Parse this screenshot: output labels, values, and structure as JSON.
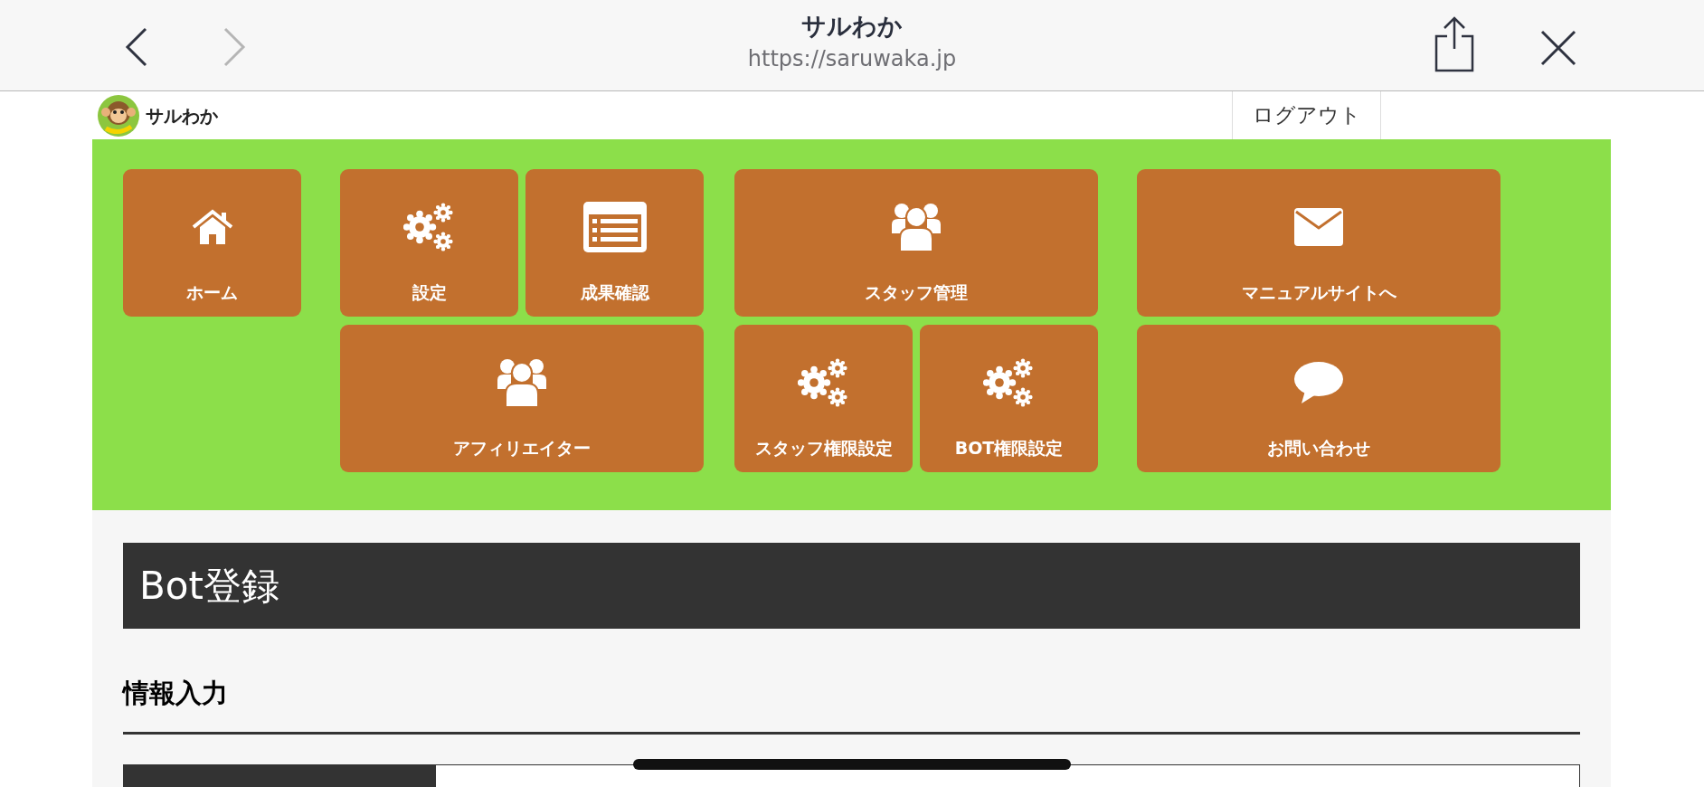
{
  "browser": {
    "title": "サルわか",
    "url": "https://saruwaka.jp"
  },
  "site": {
    "logo_text": "サルわか",
    "logout": "ログアウト"
  },
  "menu_groups": [
    {
      "tiles": [
        {
          "label": "ホーム",
          "kind": "home"
        }
      ]
    },
    {
      "tiles": [
        {
          "label": "設定",
          "kind": "gears"
        },
        {
          "label": "成果確認",
          "kind": "list"
        },
        {
          "label": "アフィリエイター",
          "kind": "people"
        }
      ]
    },
    {
      "tiles": [
        {
          "label": "スタッフ管理",
          "kind": "people"
        },
        {
          "label": "スタッフ権限設定",
          "kind": "gears"
        },
        {
          "label": "BOT権限設定",
          "kind": "gears"
        }
      ]
    },
    {
      "tiles": [
        {
          "label": "マニュアルサイトへ",
          "kind": "mail"
        },
        {
          "label": "お問い合わせ",
          "kind": "chat"
        }
      ]
    }
  ],
  "page_title": "Bot登録",
  "section_title": "情報入力"
}
